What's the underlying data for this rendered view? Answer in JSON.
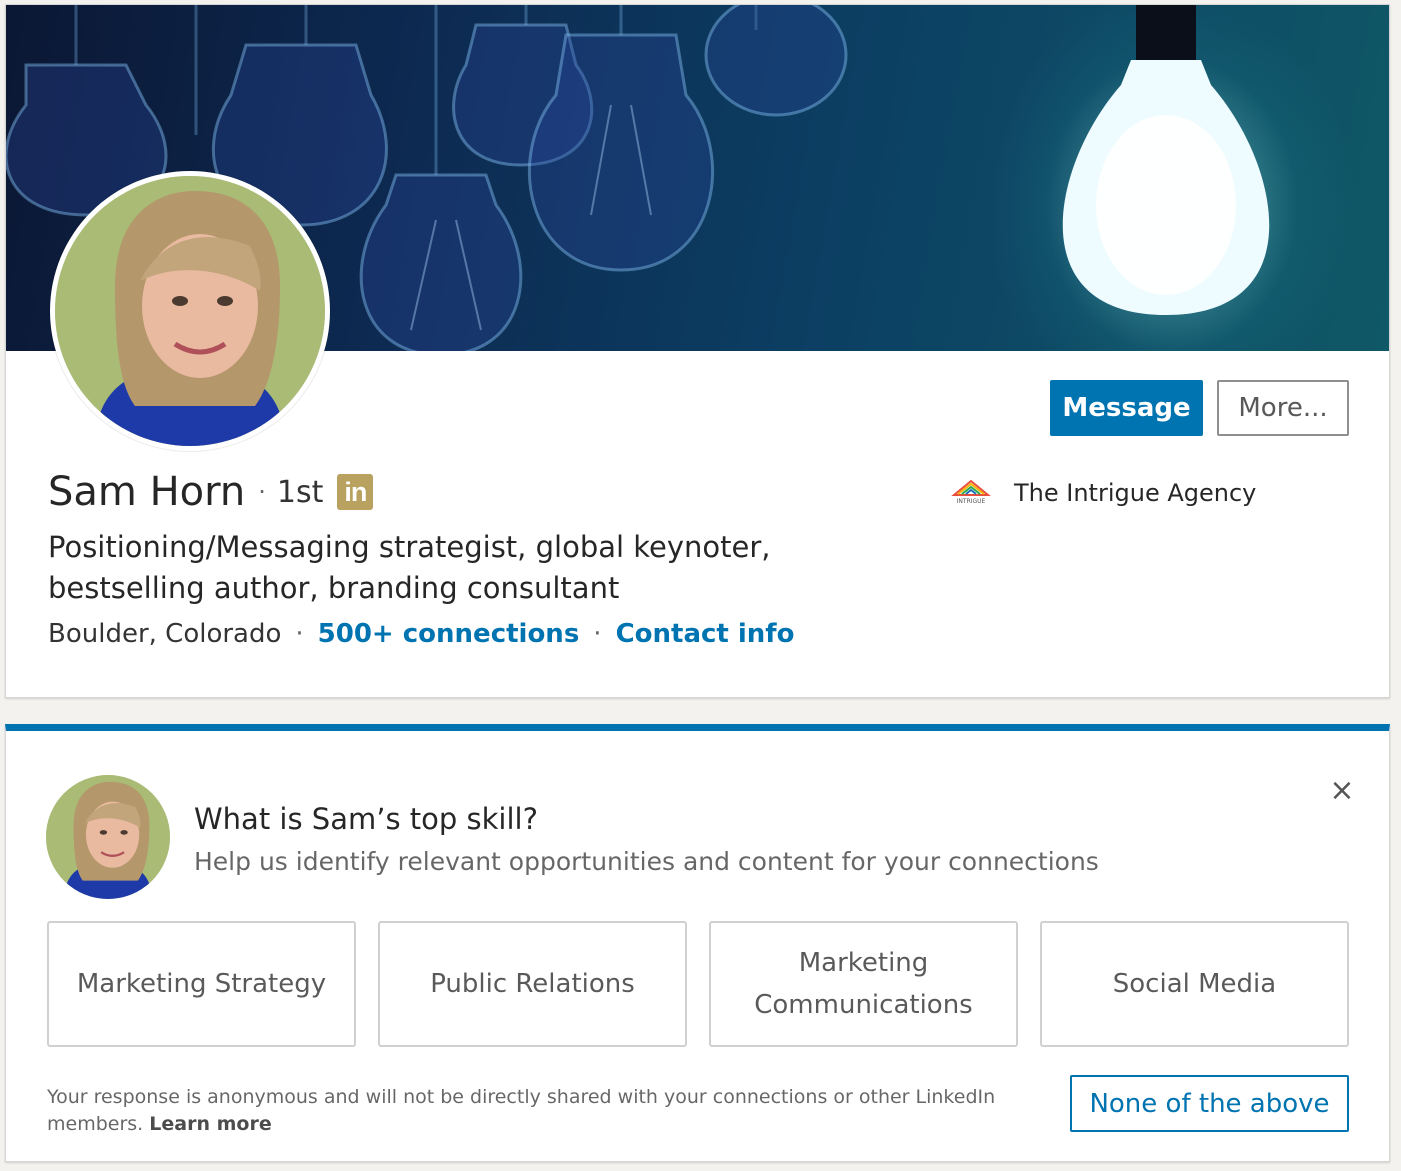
{
  "profile": {
    "name": "Sam Horn",
    "connection_degree": "1st",
    "linkedin_badge": "in",
    "headline": "Positioning/Messaging strategist, global keynoter, bestselling author, branding consultant",
    "location": "Boulder, Colorado",
    "connections": "500+ connections",
    "contact_info": "Contact info",
    "separator": "·",
    "actions": {
      "message_label": "Message",
      "more_label": "More..."
    },
    "company": {
      "name": "The Intrigue Agency",
      "logo_text": "INTRIGUE"
    },
    "banner_icon": "lightbulbs-banner-image",
    "avatar_icon": "profile-photo"
  },
  "skill_prompt": {
    "title": "What is Sam’s top skill?",
    "subtitle": "Help us identify relevant opportunities and content for your connections",
    "close_icon": "×",
    "options": [
      "Marketing Strategy",
      "Public Relations",
      "Marketing Communications",
      "Social Media"
    ],
    "disclaimer": "Your response is anonymous and will not be directly shared with your connections or other LinkedIn members.",
    "learn_more": "Learn more",
    "none_label": "None of the above"
  },
  "colors": {
    "accent": "#0073b1",
    "badge_gold": "#b9a15f",
    "page_bg": "#f3f2ef"
  }
}
